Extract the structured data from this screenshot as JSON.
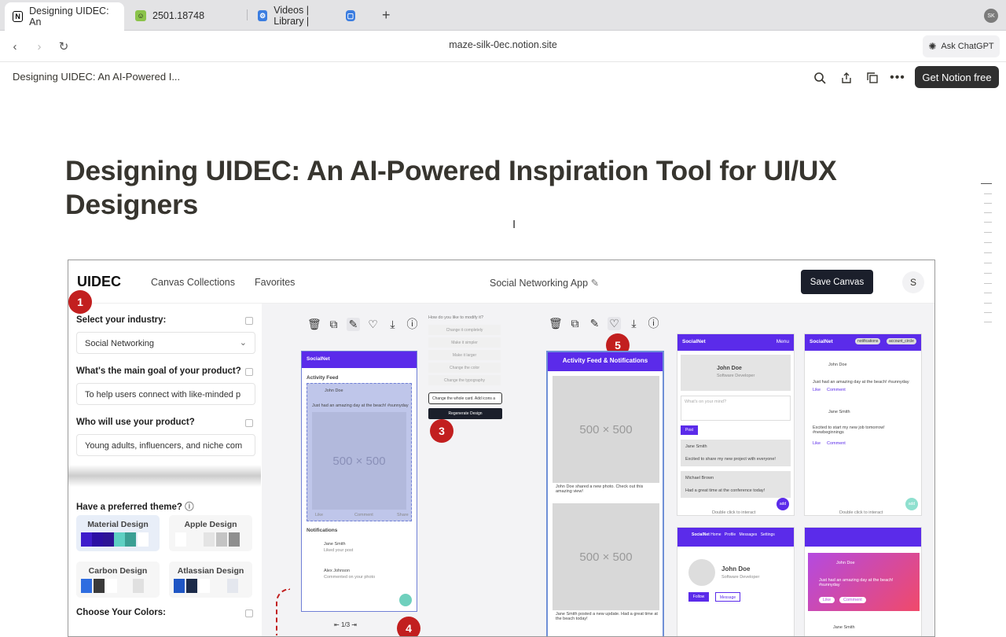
{
  "browser": {
    "tabs": [
      {
        "label": "Designing UIDEC: An",
        "active": true,
        "icon": "notion-icon"
      },
      {
        "label": "2501.18748",
        "active": false,
        "icon": "arxiv-icon"
      },
      {
        "label": "Videos | Library |",
        "active": false,
        "icon": "settings-app-icon"
      }
    ],
    "profile_initials": "SK",
    "url": "maze-silk-0ec.notion.site",
    "ask_chatgpt": "Ask ChatGPT"
  },
  "notion": {
    "breadcrumb": "Designing UIDEC: An AI-Powered I...",
    "get_notion_free": "Get Notion free",
    "page_title": "Designing UIDEC: An AI-Powered Inspiration Tool for UI/UX Designers"
  },
  "screenshot": {
    "logo": "UIDEC",
    "nav": {
      "canvas_collections": "Canvas Collections",
      "favorites": "Favorites"
    },
    "project_name": "Social Networking App",
    "save_canvas": "Save Canvas",
    "avatar": "S",
    "panel": {
      "industry_q": "Select your industry:",
      "industry_val": "Social Networking",
      "goal_q": "What's the main goal of your product?",
      "goal_val": "To help users connect with like-minded p",
      "users_q": "Who will use your product?",
      "users_val": "Young adults, influencers, and niche com",
      "theme_q": "Have a preferred theme?",
      "themes": [
        "Material Design",
        "Apple Design",
        "Carbon Design",
        "Atlassian Design"
      ],
      "colors_q": "Choose Your Colors:"
    },
    "canvas": {
      "brand": "SocialNet",
      "feed_title": "Activity Feed",
      "john": "John Doe",
      "post": "Just had an amazing day at the beach! #sunnyday",
      "placeholder": "500 × 500",
      "like": "Like",
      "comment": "Comment",
      "share": "Share",
      "notifications": "Notifications",
      "jane": "Jane Smith",
      "jane_note": "Liked your post",
      "alex": "Alex Johnson",
      "alex_note": "Commented on your photo",
      "pager": "1/3",
      "modify_q": "How do you like to modify it?",
      "options": [
        "Change it completely",
        "Make it simpler",
        "Make it larger",
        "Change the color",
        "Change the typography"
      ],
      "modify_input": "Change the whole card. Add icons a",
      "regenerate": "Regenerate Design",
      "feed2_title": "Activity Feed & Notifications",
      "feed2_cap1": "John Doe shared a new photo. Check out this amazing view!",
      "feed2_cap2": "Jane Smith posted a new update. Had a great time at the beach today!",
      "menu": "Menu",
      "dev": "Software Developer",
      "mind": "What's on your mind?",
      "post_btn": "Post",
      "excited": "Excited to share my new project with everyone!",
      "michael": "Michael Brown",
      "conf": "Had a great time at the conference today!",
      "add": "add",
      "double_click": "Double click to interact",
      "notif_chip": "notifications",
      "account_chip": "account_circle",
      "newjob": "Excited to start my new job tomorrow! #newbeginnings",
      "nav_items": [
        "Home",
        "Profile",
        "Messages",
        "Settings"
      ],
      "follow": "Follow",
      "message": "Message",
      "markers": [
        "1",
        "3",
        "4",
        "5"
      ]
    }
  },
  "colors": {
    "purple": "#5b2bea",
    "marker_red": "#c21f1f",
    "dark_btn": "#1b1f2b"
  }
}
